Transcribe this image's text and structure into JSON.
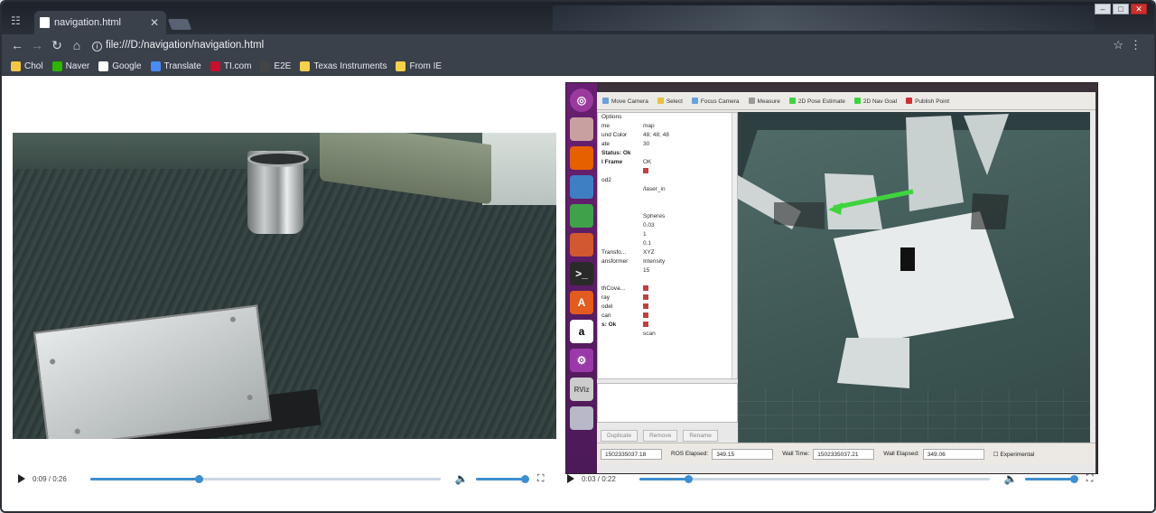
{
  "browser": {
    "tab_title": "navigation.html",
    "url": "file:///D:/navigation/navigation.html",
    "bookmarks": [
      {
        "label": "Chol",
        "color": "#f2c744"
      },
      {
        "label": "Naver",
        "color": "#2db400"
      },
      {
        "label": "Google",
        "color": "#ffffff"
      },
      {
        "label": "Translate",
        "color": "#4a8af4"
      },
      {
        "label": "TI.com",
        "color": "#c8102e"
      },
      {
        "label": "E2E",
        "color": "#444444"
      },
      {
        "label": "Texas Instruments",
        "color": "#f5d04a"
      },
      {
        "label": "From IE",
        "color": "#f5d04a"
      }
    ]
  },
  "video_left": {
    "time": "0:09 / 0:26",
    "progress": 0.31,
    "volume": 1.0
  },
  "video_right": {
    "time": "0:03 / 0:22",
    "progress": 0.14,
    "volume": 1.0,
    "rviz": {
      "toolbar": [
        "Move Camera",
        "Select",
        "Focus Camera",
        "Measure",
        "2D Pose Estimate",
        "2D Nav Goal",
        "Publish Point"
      ],
      "displays": [
        {
          "label": "Options",
          "value": ""
        },
        {
          "label": "me",
          "value": "map"
        },
        {
          "label": "und Color",
          "value": "48; 48; 48"
        },
        {
          "label": "ate",
          "value": "30"
        },
        {
          "label": "Status: Ok",
          "value": ""
        },
        {
          "label": "l Frame",
          "value": "OK"
        },
        {
          "label": "",
          "value": "check"
        },
        {
          "label": "od2",
          "value": ""
        },
        {
          "label": "",
          "value": "/laser_in"
        },
        {
          "label": "",
          "value": ""
        },
        {
          "label": "",
          "value": ""
        },
        {
          "label": "",
          "value": "Spheres"
        },
        {
          "label": "",
          "value": "0.03"
        },
        {
          "label": "",
          "value": "1"
        },
        {
          "label": "",
          "value": "0.1"
        },
        {
          "label": "Transfo...",
          "value": "XYZ"
        },
        {
          "label": "ansformer",
          "value": "Intensity"
        },
        {
          "label": "",
          "value": "15"
        },
        {
          "label": "",
          "value": ""
        },
        {
          "label": "thCova...",
          "value": "check"
        },
        {
          "label": "ray",
          "value": "check"
        },
        {
          "label": "odel",
          "value": "check"
        },
        {
          "label": "can",
          "value": "check"
        },
        {
          "label": "s: Ok",
          "value": "check"
        },
        {
          "label": "",
          "value": "scan"
        }
      ],
      "buttons": [
        "Duplicate",
        "Remove",
        "Rename"
      ],
      "status": {
        "ros_time": "1502335037.18",
        "ros_elapsed_label": "ROS Elapsed:",
        "ros_elapsed": "349.15",
        "wall_time_label": "Wall Time:",
        "wall_time": "1502335037.21",
        "wall_elapsed_label": "Wall Elapsed:",
        "wall_elapsed": "349.06",
        "experimental": "Experimental"
      }
    }
  }
}
